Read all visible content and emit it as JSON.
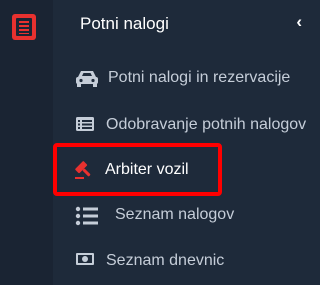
{
  "sidebar": {
    "rail": {
      "icon": "document-list-icon",
      "accent": "#e8312f"
    },
    "header": {
      "title": "Potni nalogi",
      "collapse_glyph": "‹"
    },
    "items": [
      {
        "label": "Potni nalogi in rezervacije",
        "icon": "car-icon",
        "active": false
      },
      {
        "label": "Odobravanje potnih nalogov",
        "icon": "list-card-icon",
        "active": false
      },
      {
        "label": "Arbiter vozil",
        "icon": "gavel-icon",
        "active": true
      },
      {
        "label": "Seznam nalogov",
        "icon": "bulleted-list-icon",
        "active": false
      },
      {
        "label": "Seznam dnevnic",
        "icon": "money-bill-icon",
        "active": false
      }
    ]
  },
  "colors": {
    "background": "#1e2a3a",
    "rail": "#1a2433",
    "text": "#c5cdd8",
    "active_icon": "#e8312f",
    "highlight": "#ff0000"
  }
}
